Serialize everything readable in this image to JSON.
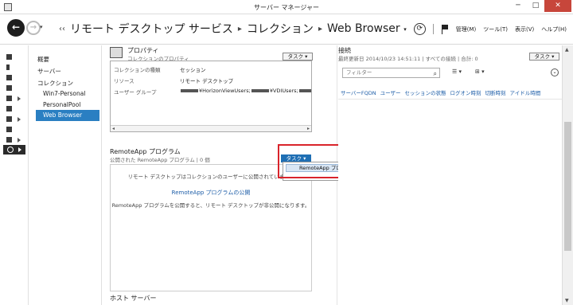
{
  "window": {
    "title": "サーバー マネージャー",
    "min": "─",
    "max": "□",
    "close": "✕"
  },
  "nav": {
    "back": "←",
    "forward": "→",
    "dropdown": "▾",
    "breadcrumb": [
      "リモート デスクトップ サービス",
      "コレクション",
      "Web Browser"
    ],
    "bc_prefix": "‹‹",
    "bc_sep": "▸",
    "refresh": "⟳",
    "refresh_dd": "▾",
    "menus": [
      "管理(M)",
      "ツール(T)",
      "表示(V)",
      "ヘルプ(H)"
    ]
  },
  "sidebar": {
    "items": [
      "概要",
      "サーバー",
      "コレクション",
      "Win7-Personal",
      "PersonalPool",
      "Web Browser"
    ]
  },
  "properties": {
    "title": "プロパティ",
    "subtitle": "コレクションのプロパティ",
    "task_label": "タスク ▾",
    "rows": [
      {
        "key": "コレクションの種類",
        "value": "セッション"
      },
      {
        "key": "リソース",
        "value": "リモート デスクトップ"
      },
      {
        "key": "ユーザー グループ",
        "value_a": "¥HorizonViewUsers;",
        "value_b": "¥VDIUsers;"
      }
    ],
    "scroll_left": "◂",
    "scroll_right": "▸"
  },
  "remoteapp": {
    "title": "RemoteApp プログラム",
    "subtitle": "公開された RemoteApp プログラム | 0 個",
    "task_label": "タスク ▾",
    "message1": "リモート デスクトップはコレクションのユーザーに公開されています。",
    "link": "RemoteApp プログラムの公開",
    "message2": "RemoteApp プログラムを公開すると、リモート デスクトップが非公開になります。"
  },
  "dropdown": {
    "item": "RemoteApp プログラムの公開(P)"
  },
  "host": {
    "title": "ホスト サーバー"
  },
  "connections": {
    "title": "接続",
    "subtitle": "最終更新日 2014/10/23 14:51:11 | すべての接続 | 合計: 0",
    "task_label": "タスク ▾",
    "filter_placeholder": "フィルター",
    "search_icon": "⌕",
    "view_ctrl": "☰ ▾",
    "sort_ctrl": "⊞ ▾",
    "collapse": "⌄",
    "columns": [
      "サーバーFQDN",
      "ユーザー",
      "セッションの状態",
      "ログオン時刻",
      "切断時刻",
      "アイドル時間"
    ]
  },
  "scrollbar": {
    "up": "▲",
    "down": "▼"
  }
}
